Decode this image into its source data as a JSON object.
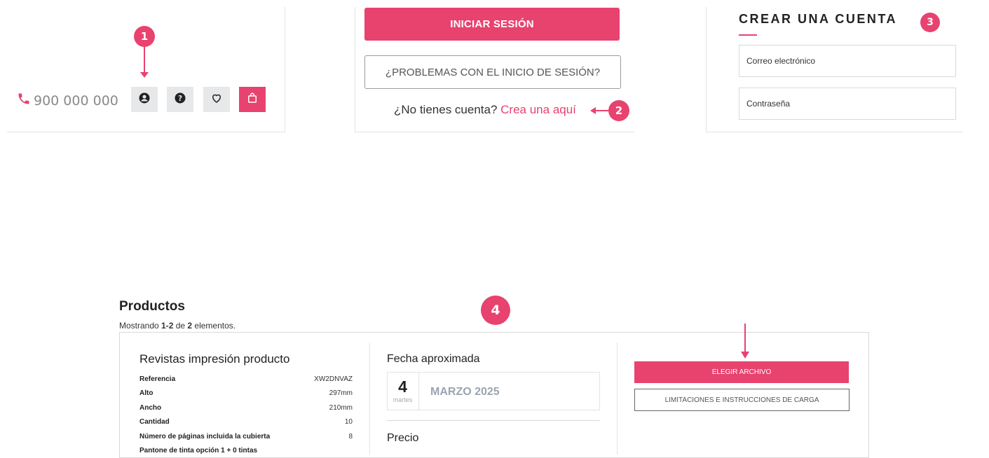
{
  "header_panel": {
    "phone": "900 000 000",
    "badge": "1",
    "icons": [
      "user-icon",
      "help-icon",
      "heart-icon",
      "bag-icon"
    ]
  },
  "login_panel": {
    "login_button": "INICIAR SESIÓN",
    "trouble_button": "¿PROBLEMAS CON EL INICIO DE SESIÓN?",
    "no_account_text": "¿No tienes cuenta?",
    "create_link": "Crea una aquí",
    "badge": "2"
  },
  "register_panel": {
    "title": "CREAR UNA CUENTA",
    "badge": "3",
    "email_placeholder": "Correo electrónico",
    "password_placeholder": "Contraseña"
  },
  "products": {
    "title": "Productos",
    "badge": "4",
    "showing_prefix": "Mostrando ",
    "showing_range": "1-2",
    "showing_mid": " de ",
    "showing_total": "2",
    "showing_suffix": " elementos.",
    "product": {
      "name": "Revistas impresión producto",
      "specs": [
        {
          "label": "Referencia",
          "value": "XW2DNVAZ"
        },
        {
          "label": "Alto",
          "value": "297mm"
        },
        {
          "label": "Ancho",
          "value": "210mm"
        },
        {
          "label": "Cantidad",
          "value": "10"
        },
        {
          "label": "Número de páginas incluida la cubierta",
          "value": "8"
        },
        {
          "label": "Pantone de tinta opción 1 + 0 tintas",
          "value": ""
        }
      ]
    },
    "date": {
      "title": "Fecha aproximada",
      "day": "4",
      "weekday": "martes",
      "month_year": "MARZO 2025"
    },
    "price_title": "Precio",
    "upload_button": "ELEGIR ARCHIVO",
    "instructions_button": "LIMITACIONES E INSTRUCCIONES DE CARGA"
  },
  "colors": {
    "accent": "#e8426f",
    "panel_border": "#e3e3e3"
  }
}
